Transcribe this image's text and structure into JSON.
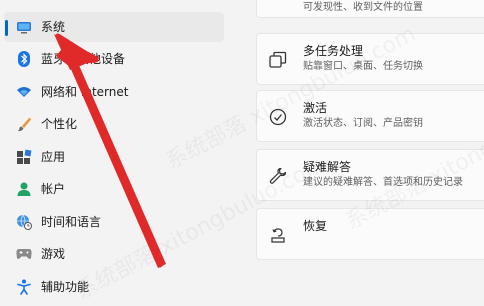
{
  "sidebar": {
    "items": [
      {
        "label": "系统",
        "icon": "monitor-icon",
        "active": true
      },
      {
        "label": "蓝牙和其他设备",
        "icon": "bluetooth-icon"
      },
      {
        "label": "网络和 Internet",
        "icon": "wifi-icon"
      },
      {
        "label": "个性化",
        "icon": "brush-icon"
      },
      {
        "label": "应用",
        "icon": "apps-icon"
      },
      {
        "label": "帐户",
        "icon": "person-icon"
      },
      {
        "label": "时间和语言",
        "icon": "globe-clock-icon"
      },
      {
        "label": "游戏",
        "icon": "gamepad-icon"
      },
      {
        "label": "辅助功能",
        "icon": "accessibility-icon"
      }
    ]
  },
  "main": {
    "top_card": {
      "subtitle": "可发现性、收到文件的位置"
    },
    "cards": [
      {
        "title": "多任务处理",
        "subtitle": "贴靠窗口、桌面、任务切换",
        "icon": "multitasking-icon"
      },
      {
        "title": "激活",
        "subtitle": "激活状态、订阅、产品密钥",
        "icon": "check-circle-icon"
      },
      {
        "title": "疑难解答",
        "subtitle": "建议的疑难解答、首选项和历史记录",
        "icon": "wrench-icon"
      },
      {
        "title": "恢复",
        "icon": "recovery-icon"
      }
    ]
  },
  "watermark": "系统部落 xitongbuluo.com",
  "colors": {
    "accent": "#0067c0",
    "arrow": "#e02a2a"
  }
}
